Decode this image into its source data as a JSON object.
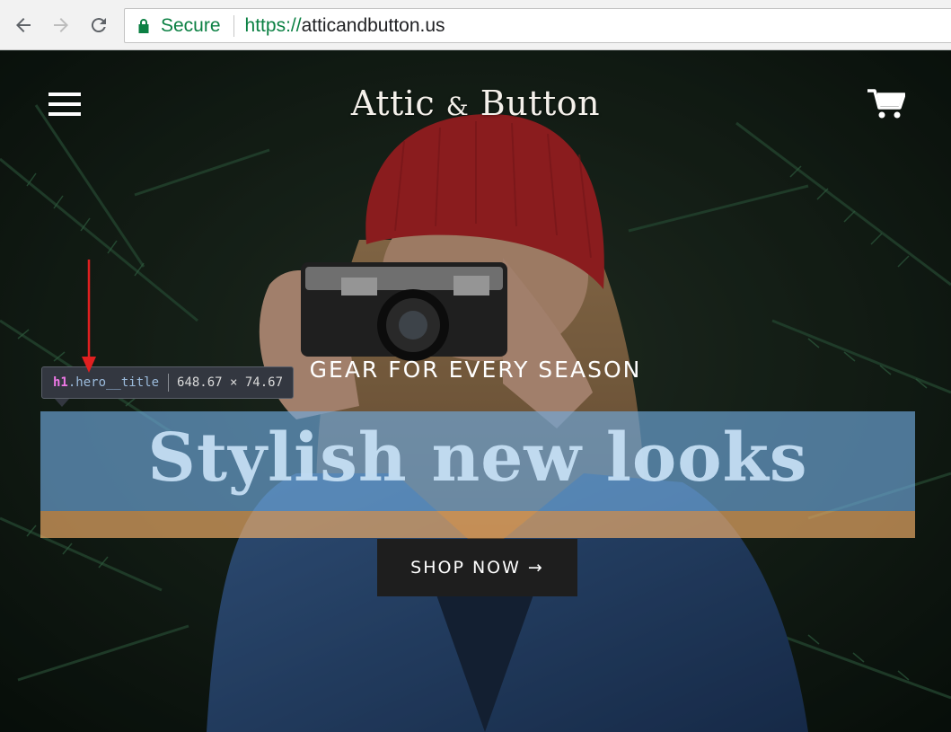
{
  "browser": {
    "secure_label": "Secure",
    "url_scheme": "https://",
    "url_host": "atticandbutton.us"
  },
  "header": {
    "logo_part1": "Attic ",
    "logo_amp": "&",
    "logo_part2": " Button"
  },
  "hero": {
    "subtitle": "GEAR FOR EVERY SEASON",
    "title": "Stylish new looks",
    "button_label": "SHOP NOW →"
  },
  "devtools": {
    "tag": "h1",
    "class_name": ".hero__title",
    "dimensions": "648.67 × 74.67"
  },
  "colors": {
    "secure_green": "#0b8043",
    "highlight_content": "#6fa8dc",
    "highlight_margin": "#f6b26b",
    "annotation_arrow": "#e02020",
    "hat_red": "#c0282a"
  }
}
